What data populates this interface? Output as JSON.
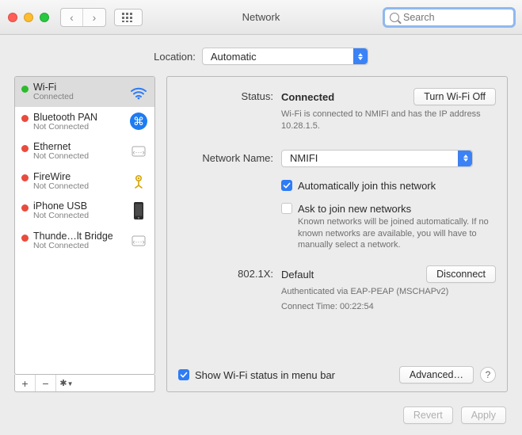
{
  "titlebar": {
    "title": "Network",
    "search_placeholder": "Search"
  },
  "location": {
    "label": "Location:",
    "value": "Automatic"
  },
  "services": [
    {
      "name": "Wi-Fi",
      "sub": "Connected",
      "status": "green",
      "icon": "wifi",
      "selected": true
    },
    {
      "name": "Bluetooth PAN",
      "sub": "Not Connected",
      "status": "red",
      "icon": "bluetooth"
    },
    {
      "name": "Ethernet",
      "sub": "Not Connected",
      "status": "red",
      "icon": "ethernet"
    },
    {
      "name": "FireWire",
      "sub": "Not Connected",
      "status": "red",
      "icon": "firewire"
    },
    {
      "name": "iPhone USB",
      "sub": "Not Connected",
      "status": "red",
      "icon": "iphone"
    },
    {
      "name": "Thunde…lt Bridge",
      "sub": "Not Connected",
      "status": "red",
      "icon": "ethernet"
    }
  ],
  "sidebar_buttons": {
    "add": "+",
    "remove": "−",
    "gear": "✻▾"
  },
  "detail": {
    "status_label": "Status:",
    "status_value": "Connected",
    "wifi_toggle": "Turn Wi-Fi Off",
    "status_desc": "Wi-Fi is connected to NMIFI and has the IP address 10.28.1.5.",
    "netname_label": "Network Name:",
    "netname_value": "NMIFI",
    "auto_join": {
      "checked": true,
      "label": "Automatically join this network"
    },
    "ask_join": {
      "checked": false,
      "label": "Ask to join new networks",
      "desc": "Known networks will be joined automatically. If no known networks are available, you will have to manually select a network."
    },
    "dot1x_label": "802.1X:",
    "dot1x_value": "Default",
    "dot1x_button": "Disconnect",
    "dot1x_desc1": "Authenticated via EAP-PEAP (MSCHAPv2)",
    "dot1x_desc2": "Connect Time: 00:22:54",
    "show_menu": {
      "checked": true,
      "label": "Show Wi-Fi status in menu bar"
    },
    "advanced": "Advanced…"
  },
  "footer": {
    "revert": "Revert",
    "apply": "Apply"
  }
}
